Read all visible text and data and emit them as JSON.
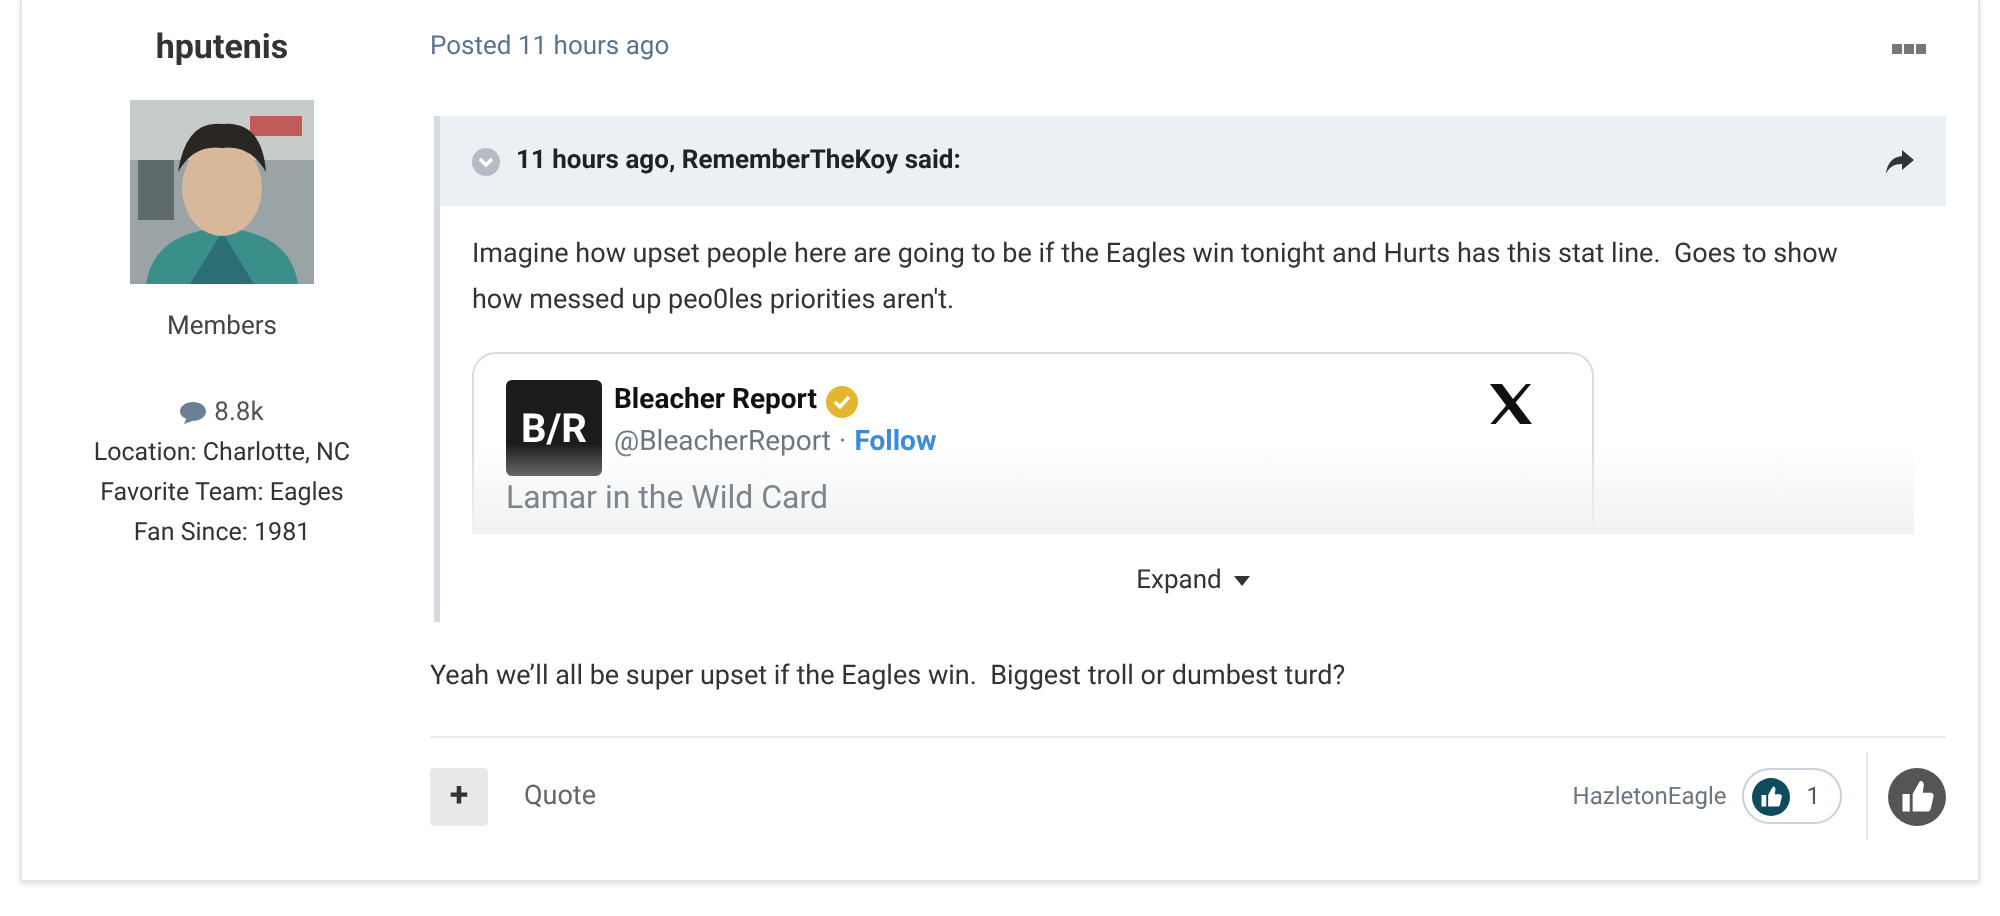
{
  "author": {
    "name": "hputenis",
    "group": "Members",
    "posts": "8.8k",
    "fields": [
      {
        "label": "Location:",
        "value": "Charlotte, NC"
      },
      {
        "label": "Favorite Team:",
        "value": "Eagles"
      },
      {
        "label": "Fan Since:",
        "value": "1981"
      }
    ]
  },
  "post": {
    "posted": "Posted 11 hours ago",
    "quote": {
      "citation": "11 hours ago, RememberTheKoy said:",
      "text": "Imagine how upset people here are going to be if the Eagles win tonight and Hurts has this stat line.  Goes to show how messed up peo0les priorities aren't.",
      "embed": {
        "logo": "B/R",
        "name": "Bleacher Report",
        "handle": "@BleacherReport",
        "separator": "·",
        "follow": "Follow",
        "preview": "Lamar in the Wild Card"
      },
      "expand": "Expand"
    },
    "reply": "Yeah we’ll all be super upset if the Eagles win.  Biggest troll or dumbest turd?"
  },
  "footer": {
    "add": "+",
    "quote": "Quote",
    "liker": "HazletonEagle",
    "likes": "1"
  }
}
